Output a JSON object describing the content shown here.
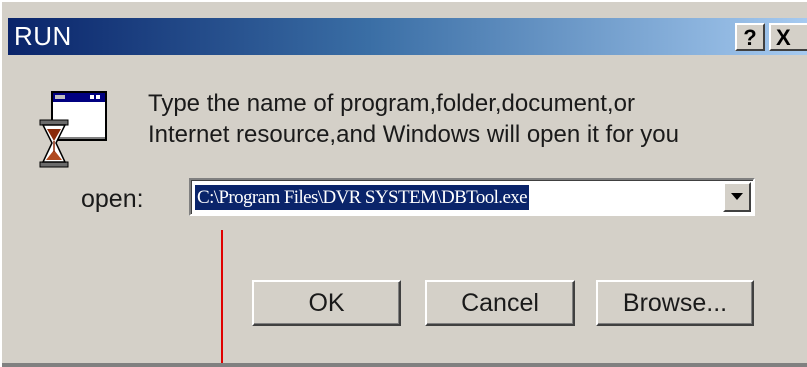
{
  "window": {
    "title": "RUN",
    "help_label": "?",
    "close_label": "X"
  },
  "icons": {
    "run": "run-program-hourglass-icon",
    "dropdown": "chevron-down-icon"
  },
  "prompt": {
    "line1": "Type the name of program,folder,document,or",
    "line2": "Internet resource,and Windows will open it for you"
  },
  "open_field": {
    "label": "open:",
    "value": "C:\\Program Files\\DVR SYSTEM\\DBTool.exe"
  },
  "buttons": {
    "ok": "OK",
    "cancel": "Cancel",
    "browse": "Browse..."
  },
  "colors": {
    "title_start": "#0a246a",
    "title_end": "#a6caf0",
    "face": "#d4d0c8",
    "selection": "#0a246a",
    "annotation_line": "#e00000"
  }
}
